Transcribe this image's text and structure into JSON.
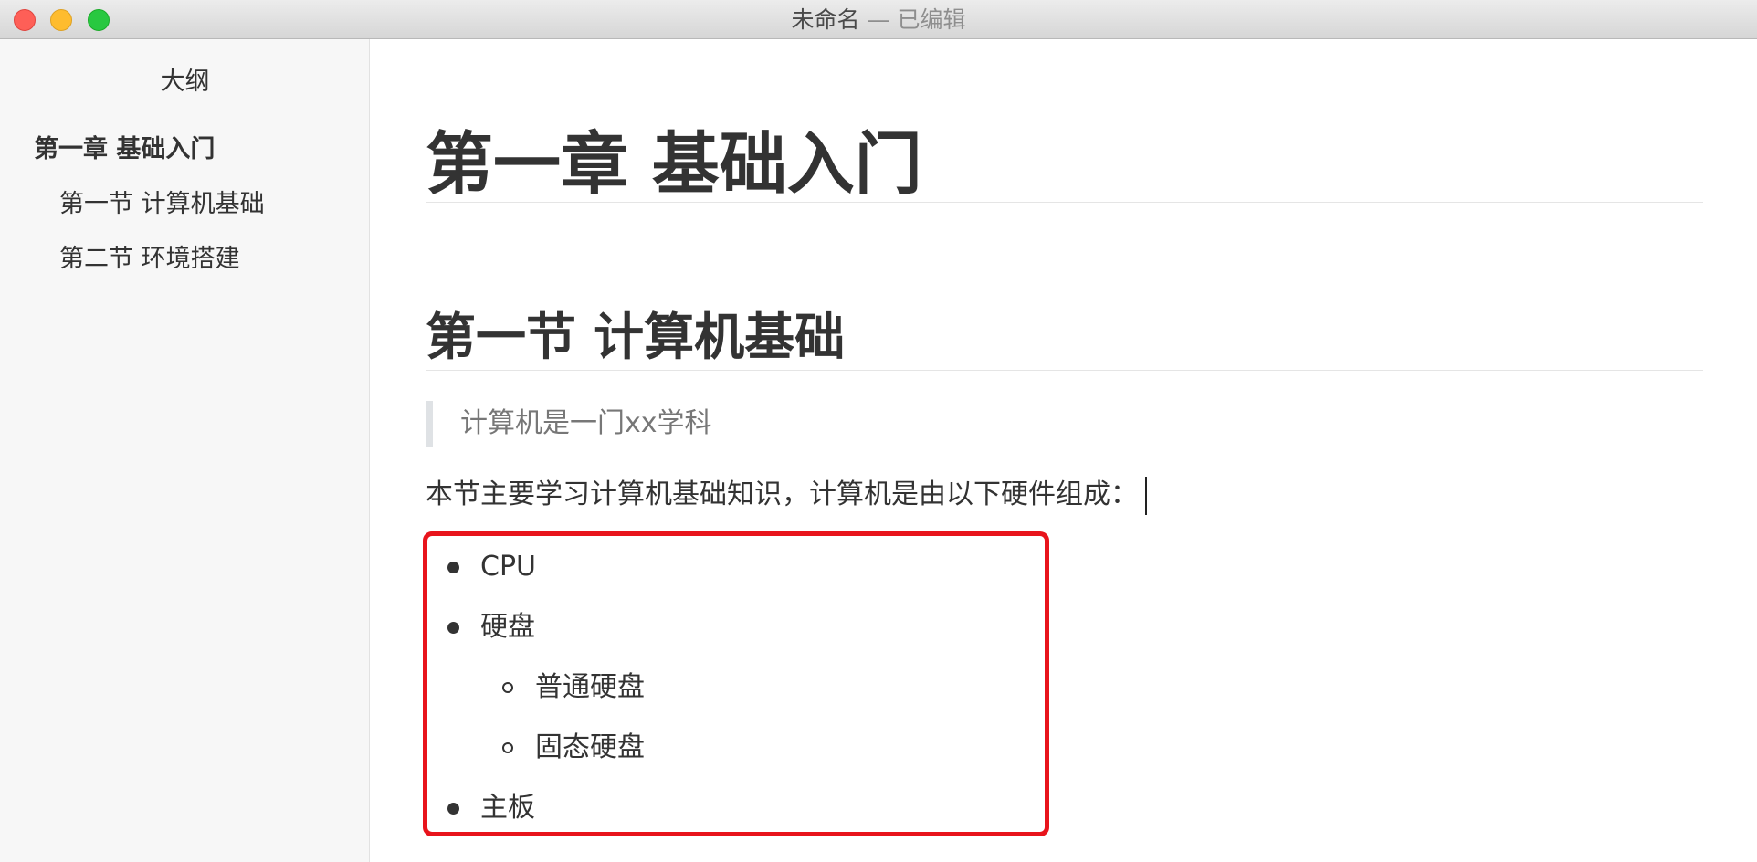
{
  "window": {
    "title_name": "未命名",
    "title_separator": "—",
    "title_state": "已编辑"
  },
  "sidebar": {
    "title": "大纲",
    "items": [
      {
        "label": "第一章 基础入门",
        "level": 1
      },
      {
        "label": "第一节 计算机基础",
        "level": 2
      },
      {
        "label": "第二节 环境搭建",
        "level": 2
      }
    ]
  },
  "document": {
    "h1": "第一章 基础入门",
    "h2": "第一节 计算机基础",
    "blockquote": "计算机是一门xx学科",
    "paragraph": "本节主要学习计算机基础知识，计算机是由以下硬件组成：",
    "list": [
      {
        "text": "CPU",
        "level": 1
      },
      {
        "text": "硬盘",
        "level": 1
      },
      {
        "text": "普通硬盘",
        "level": 2
      },
      {
        "text": "固态硬盘",
        "level": 2
      },
      {
        "text": "主板",
        "level": 1
      }
    ]
  },
  "colors": {
    "highlight_border": "#e8141c",
    "close": "#fe5f57",
    "minimize": "#febc2e",
    "zoom": "#28c840"
  }
}
